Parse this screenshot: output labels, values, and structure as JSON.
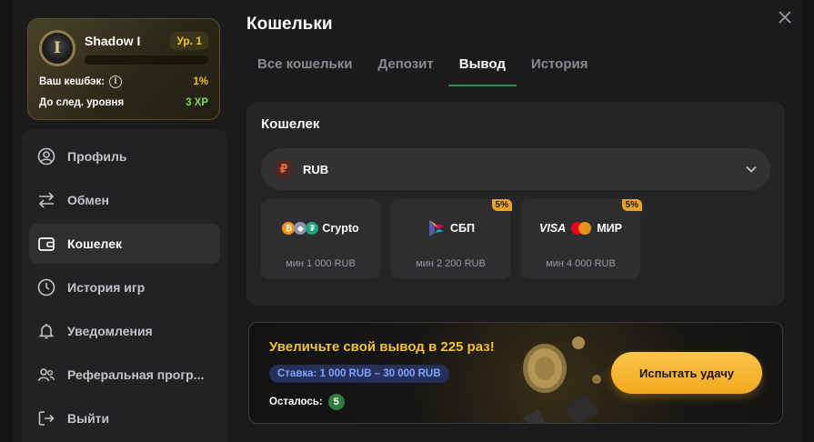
{
  "profile": {
    "username": "Shadow I",
    "avatar_letter": "I",
    "level": "Ур. 1",
    "xp_progress": 0,
    "cashback_label": "Ваш кешбэк:",
    "cashback_value": "1%",
    "next_level_label": "До след. уровня",
    "next_level_value": "3 XP"
  },
  "sidebar": {
    "items": [
      {
        "label": "Профиль",
        "icon": "user-icon",
        "active": false
      },
      {
        "label": "Обмен",
        "icon": "exchange-icon",
        "active": false
      },
      {
        "label": "Кошелек",
        "icon": "wallet-icon",
        "active": true
      },
      {
        "label": "История игр",
        "icon": "history-icon",
        "active": false
      },
      {
        "label": "Уведомления",
        "icon": "bell-icon",
        "active": false
      },
      {
        "label": "Реферальная прогр...",
        "icon": "referral-icon",
        "active": false
      },
      {
        "label": "Выйти",
        "icon": "logout-icon",
        "active": false
      }
    ]
  },
  "page": {
    "title": "Кошельки",
    "tabs": [
      {
        "label": "Все кошельки",
        "active": false
      },
      {
        "label": "Депозит",
        "active": false
      },
      {
        "label": "Вывод",
        "active": true
      },
      {
        "label": "История",
        "active": false
      }
    ]
  },
  "wallet": {
    "title": "Кошелек",
    "currency_symbol": "₽",
    "currency": "RUB",
    "methods": [
      {
        "name": "Crypto",
        "min": "мин 1 000 RUB",
        "badge": ""
      },
      {
        "name": "СБП",
        "min": "мин 2 200 RUB",
        "badge": "5%"
      },
      {
        "name": "VISA",
        "name2": "МИР",
        "min": "мин 4 000 RUB",
        "badge": "5%"
      }
    ]
  },
  "promo": {
    "title": "Увеличьте свой вывод в 225 раз!",
    "rate": "Ставка: 1 000 RUB – 30 000 RUB",
    "remaining_label": "Осталось:",
    "remaining_count": "5",
    "button_label": "Испытать удачу"
  },
  "colors": {
    "accent_gold": "#f2c230",
    "active_tab_underline": "#2f8a4b",
    "button": "#f2a91e"
  }
}
